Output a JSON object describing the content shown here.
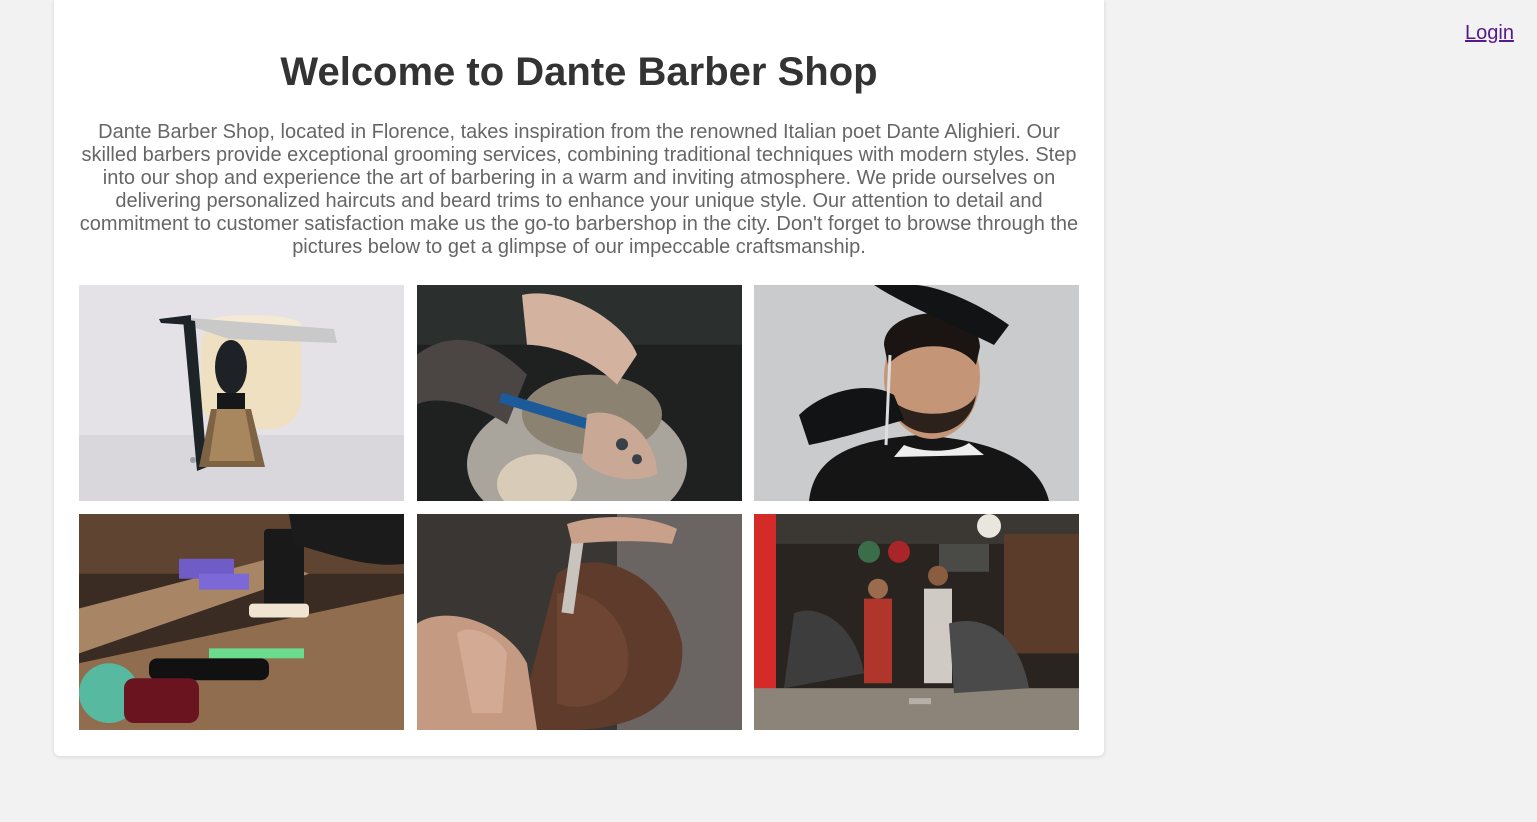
{
  "nav": {
    "login_label": "Login"
  },
  "main": {
    "title": "Welcome to Dante Barber Shop",
    "intro": "Dante Barber Shop, located in Florence, takes inspiration from the renowned Italian poet Dante Alighieri. Our skilled barbers provide exceptional grooming services, combining traditional techniques with modern styles. Step into our shop and experience the art of barbering in a warm and inviting atmosphere. We pride ourselves on delivering personalized haircuts and beard trims to enhance your unique style. Our attention to detail and commitment to customer satisfaction make us the go-to barbershop in the city. Don't forget to browse through the pictures below to get a glimpse of our impeccable craftsmanship."
  },
  "gallery": {
    "photos": [
      {
        "subject": "straight-razor-and-shaving-brush"
      },
      {
        "subject": "haircut-with-comb"
      },
      {
        "subject": "beard-trim-gloved-barber"
      },
      {
        "subject": "barber-tools-on-shelf"
      },
      {
        "subject": "beard-shave-closeup"
      },
      {
        "subject": "barbershop-interior"
      }
    ]
  },
  "colors": {
    "page_background": "#f2f2f2",
    "card_background": "#ffffff",
    "title_text": "#333333",
    "body_text": "#666666",
    "link": "#551a8b"
  }
}
